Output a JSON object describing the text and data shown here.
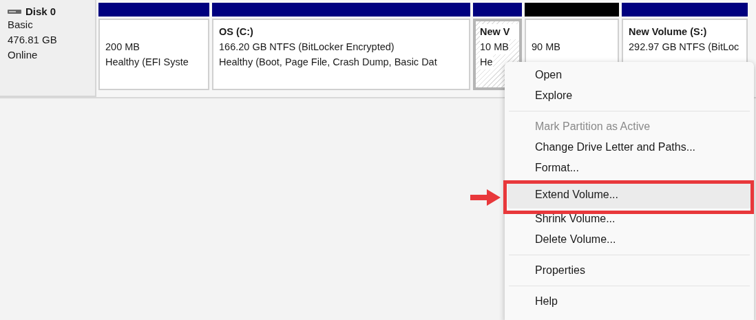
{
  "disk": {
    "name": "Disk 0",
    "type": "Basic",
    "size": "476.81 GB",
    "status": "Online"
  },
  "partitions": [
    {
      "kind": "primary",
      "selected": false,
      "lines": [
        "200 MB",
        "Healthy (EFI Syste"
      ]
    },
    {
      "kind": "primary",
      "selected": false,
      "title": "OS  (C:)",
      "lines": [
        "166.20 GB NTFS (BitLocker Encrypted)",
        "Healthy (Boot, Page File, Crash Dump, Basic Dat"
      ]
    },
    {
      "kind": "primary",
      "selected": true,
      "title": "New V",
      "lines": [
        "10 MB",
        "He"
      ]
    },
    {
      "kind": "unallocated",
      "selected": false,
      "lines": [
        "90 MB"
      ]
    },
    {
      "kind": "primary",
      "selected": false,
      "title": "New Volume  (S:)",
      "lines": [
        "292.97 GB NTFS (BitLoc"
      ]
    }
  ],
  "context_menu": [
    {
      "kind": "item",
      "label": "Open",
      "disabled": false,
      "selected": false,
      "annotated": false
    },
    {
      "kind": "item",
      "label": "Explore",
      "disabled": false,
      "selected": false,
      "annotated": false
    },
    {
      "kind": "separator"
    },
    {
      "kind": "item",
      "label": "Mark Partition as Active",
      "disabled": true,
      "selected": false,
      "annotated": false
    },
    {
      "kind": "item",
      "label": "Change Drive Letter and Paths...",
      "disabled": false,
      "selected": false,
      "annotated": false
    },
    {
      "kind": "item",
      "label": "Format...",
      "disabled": false,
      "selected": false,
      "annotated": false
    },
    {
      "kind": "item",
      "label": "Extend Volume...",
      "disabled": false,
      "selected": true,
      "annotated": true
    },
    {
      "kind": "item",
      "label": "Shrink Volume...",
      "disabled": false,
      "selected": false,
      "annotated": false
    },
    {
      "kind": "item",
      "label": "Delete Volume...",
      "disabled": false,
      "selected": false,
      "annotated": false
    },
    {
      "kind": "separator"
    },
    {
      "kind": "item",
      "label": "Properties",
      "disabled": false,
      "selected": false,
      "annotated": false
    },
    {
      "kind": "separator"
    },
    {
      "kind": "item",
      "label": "Help",
      "disabled": false,
      "selected": false,
      "annotated": false
    }
  ]
}
